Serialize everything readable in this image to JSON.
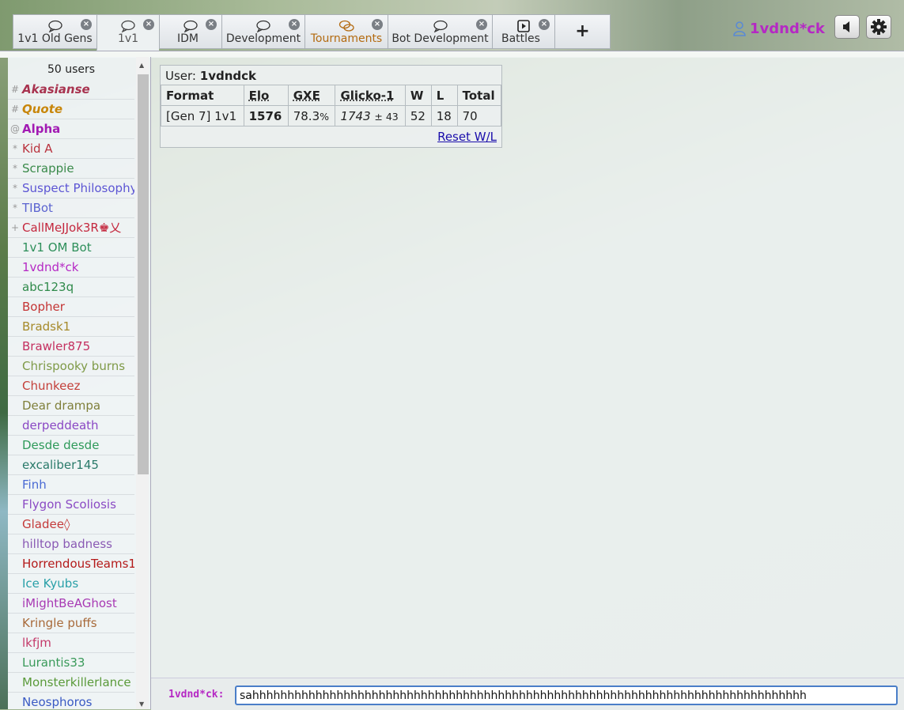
{
  "tabs": [
    {
      "label": "1v1 Old Gens",
      "icon": "chat-bubble-icon",
      "closable": true
    },
    {
      "label": "1v1",
      "icon": "chat-bubble-icon",
      "closable": true
    },
    {
      "label": "IDM",
      "icon": "chat-bubble-icon",
      "closable": true
    },
    {
      "label": "Development",
      "icon": "chat-bubble-icon",
      "closable": true
    },
    {
      "label": "Tournaments",
      "icon": "chat-bubbles-icon",
      "closable": true
    },
    {
      "label": "Bot Development",
      "icon": "chat-bubble-icon",
      "closable": true
    },
    {
      "label": "Battles",
      "icon": "battle-play-icon",
      "closable": true
    }
  ],
  "add_tab": {
    "label": "+"
  },
  "user": {
    "name": "1vdnd*ck",
    "color": "#b528c4"
  },
  "userlist": {
    "count_label": "50 users",
    "users": [
      {
        "rank": "#",
        "name": "Akasianse",
        "color": "#a8334f",
        "style": "bold-italic"
      },
      {
        "rank": "#",
        "name": "Quote",
        "color": "#c8860a",
        "style": "bold-italic"
      },
      {
        "rank": "@",
        "name": "Alpha",
        "color": "#a21bb3",
        "style": "bold"
      },
      {
        "rank": "*",
        "name": "Kid A",
        "color": "#b9333e",
        "style": "normal"
      },
      {
        "rank": "*",
        "name": "Scrappie",
        "color": "#3a8a4a",
        "style": "normal"
      },
      {
        "rank": "*",
        "name": "Suspect Philosophy",
        "color": "#5c55d4",
        "style": "normal"
      },
      {
        "rank": "*",
        "name": "TIBot",
        "color": "#5a63d0",
        "style": "normal"
      },
      {
        "rank": "+",
        "name": "CallMeJJok3R♚乂",
        "color": "#c4283e",
        "style": "normal"
      },
      {
        "rank": "",
        "name": "1v1 OM Bot",
        "color": "#2d8f5a",
        "style": "normal"
      },
      {
        "rank": "",
        "name": "1vdnd*ck",
        "color": "#b528c4",
        "style": "normal"
      },
      {
        "rank": "",
        "name": "abc123q",
        "color": "#2f8a4a",
        "style": "normal"
      },
      {
        "rank": "",
        "name": "Bopher",
        "color": "#c43434",
        "style": "normal"
      },
      {
        "rank": "",
        "name": "Bradsk1",
        "color": "#a68a2a",
        "style": "normal"
      },
      {
        "rank": "",
        "name": "Brawler875",
        "color": "#c42f5f",
        "style": "normal"
      },
      {
        "rank": "",
        "name": "Chrispooky burns",
        "color": "#7f9a48",
        "style": "normal"
      },
      {
        "rank": "",
        "name": "Chunkeez",
        "color": "#c4403a",
        "style": "normal"
      },
      {
        "rank": "",
        "name": "Dear drampa",
        "color": "#7f7f3a",
        "style": "normal"
      },
      {
        "rank": "",
        "name": "derpeddeath",
        "color": "#8a48c4",
        "style": "normal"
      },
      {
        "rank": "",
        "name": "Desde desde",
        "color": "#2f9a5a",
        "style": "normal"
      },
      {
        "rank": "",
        "name": "excaliber145",
        "color": "#2a7a6a",
        "style": "normal"
      },
      {
        "rank": "",
        "name": "Finh",
        "color": "#4a6ad4",
        "style": "normal"
      },
      {
        "rank": "",
        "name": "Flygon Scoliosis",
        "color": "#8a4ac4",
        "style": "normal"
      },
      {
        "rank": "",
        "name": "Gladee◊",
        "color": "#c43a3a",
        "style": "normal"
      },
      {
        "rank": "",
        "name": "hilltop badness",
        "color": "#8a5ab4",
        "style": "normal"
      },
      {
        "rank": "",
        "name": "HorrendousTeams1",
        "color": "#b41a1a",
        "style": "normal"
      },
      {
        "rank": "",
        "name": "Ice Kyubs",
        "color": "#2aa0a8",
        "style": "normal"
      },
      {
        "rank": "",
        "name": "iMightBeAGhost",
        "color": "#a83ab4",
        "style": "normal"
      },
      {
        "rank": "",
        "name": "Kringle puffs",
        "color": "#a86a3a",
        "style": "normal"
      },
      {
        "rank": "",
        "name": "lkfjm",
        "color": "#c43a6a",
        "style": "normal"
      },
      {
        "rank": "",
        "name": "Lurantis33",
        "color": "#3a9a5a",
        "style": "normal"
      },
      {
        "rank": "",
        "name": "Monsterkillerlance",
        "color": "#5a9a3a",
        "style": "normal"
      },
      {
        "rank": "",
        "name": "Neosphoros",
        "color": "#3a5ac4",
        "style": "normal"
      }
    ]
  },
  "stats": {
    "user_label": "User:",
    "user_name": "1vdndck",
    "headers": [
      "Format",
      "Elo",
      "GXE",
      "Glicko-1",
      "W",
      "L",
      "Total"
    ],
    "row": {
      "format": "[Gen 7] 1v1",
      "elo": "1576",
      "gxe_main": "78.3",
      "gxe_pct": "%",
      "glicko_main": "1743",
      "glicko_dev": "± 43",
      "w": "52",
      "l": "18",
      "total": "70"
    },
    "reset_label": "Reset W/L"
  },
  "chat": {
    "name_label": "1vdnd*ck:",
    "input_value": "sahhhhhhhhhhhhhhhhhhhhhhhhhhhhhhhhhhhhhhhhhhhhhhhhhhhhhhhhhhhhhhhhhhhhhhhhhhhhhhh"
  }
}
